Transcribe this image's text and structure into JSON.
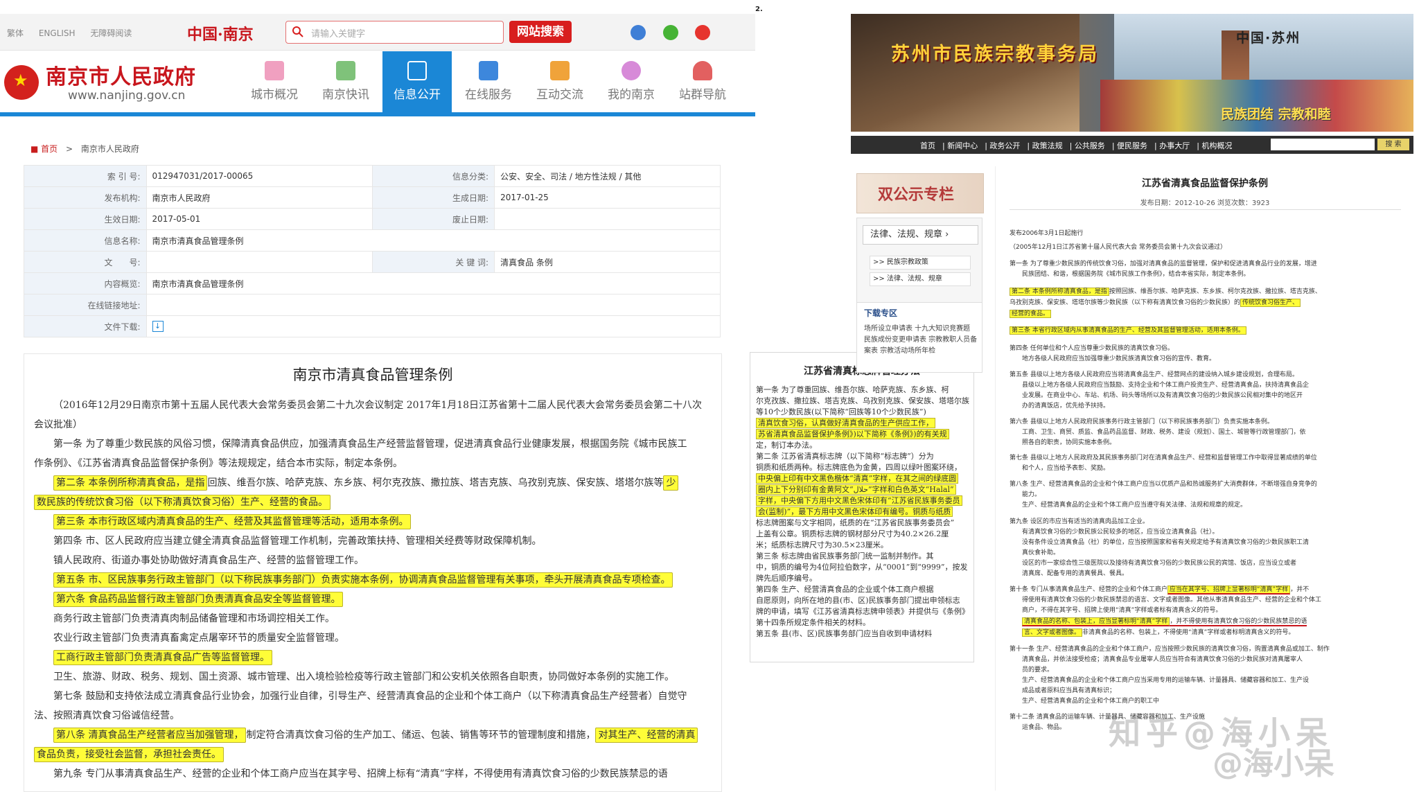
{
  "page_number": "2.",
  "nanjing": {
    "top_links": [
      "繁体",
      "ENGLISH",
      "无障碍阅读"
    ],
    "logo_text": "中国·南京",
    "search": {
      "placeholder": "请输入关键字",
      "button": "网站搜索"
    },
    "site_title": "南京市人民政府",
    "site_url": "www.nanjing.gov.cn",
    "nav": [
      "城市概况",
      "南京快讯",
      "信息公开",
      "在线服务",
      "互动交流",
      "我的南京",
      "站群导航"
    ],
    "active_nav": "信息公开",
    "colors": {
      "brand_red": "#c8161d",
      "nav_blue": "#1b87d6",
      "highlight": "#fffd38"
    },
    "breadcrumb": {
      "home": "首页",
      "sep": ">",
      "current": "南京市人民政府"
    },
    "meta": {
      "index_label": "索 引 号:",
      "index_value": "012947031/2017-00065",
      "category_label": "信息分类:",
      "category_value": "公安、安全、司法 / 地方性法规 / 其他",
      "issuer_label": "发布机构:",
      "issuer_value": "南京市人民政府",
      "created_label": "生成日期:",
      "created_value": "2017-01-25",
      "effective_label": "生效日期:",
      "effective_value": "2017-05-01",
      "abolish_label": "废止日期:",
      "abolish_value": "",
      "name_label": "信息名称:",
      "name_value": "南京市清真食品管理条例",
      "docno_label": "文　　号:",
      "docno_value": "",
      "keywords_label": "关 键 词:",
      "keywords_value": "清真食品 条例",
      "summary_label": "内容概览:",
      "summary_value": "南京市清真食品管理条例",
      "link_label": "在线链接地址:",
      "link_value": "",
      "download_label": "文件下载:"
    },
    "doc": {
      "title": "南京市清真食品管理条例",
      "lines": [
        "（2016年12月29日南京市第十五届人民代表大会常务委员会第二十九次会议制定  2017年1月18日江苏省第十二届人民代表大会常务委员会第二十八次",
        "会议批准）",
        "第一条  为了尊重少数民族的风俗习惯，保障清真食品供应，加强清真食品生产经营监督管理，促进清真食品行业健康发展，根据国务院《城市民族工",
        "作条例》、《江苏省清真食品监督保护条例》等法规规定，结合本市实际，制定本条例。"
      ],
      "art2_hl_a": "第二条  本条例所称清真食品，是指",
      "art2_mid": "回族、维吾尔族、哈萨克族、东乡族、柯尔克孜族、撒拉族、塔吉克族、乌孜别克族、保安族、塔塔尔族等",
      "art2_hl_b": "少",
      "art2_line2": "数民族的传统饮食习俗（以下称清真饮食习俗）生产、经营的食品。",
      "art3": "第三条  本市行政区域内清真食品的生产、经营及其监督管理等活动，适用本条例。",
      "art4_a": "第四条  市、区人民政府应当建立健全清真食品监督管理工作机制，完善政策扶持、管理相关经费等财政保障机制。",
      "art4_b": "镇人民政府、街道办事处协助做好清真食品生产、经营的监督管理工作。",
      "art5": "第五条  市、区民族事务行政主管部门（以下称民族事务部门）负责实施本条例，协调清真食品监督管理有关事项，牵头开展清真食品专项检查。",
      "art6": "第六条  食品药品监督行政主管部门负责清真食品安全等监督管理。",
      "art6_b": "商务行政主管部门负责清真肉制品储备管理和市场调控相关工作。",
      "art6_c": "农业行政主管部门负责清真畜禽定点屠宰环节的质量安全监督管理。",
      "art6_d": "工商行政主管部门负责清真食品广告等监督管理。",
      "art6_e": "卫生、旅游、财政、税务、规划、国土资源、城市管理、出入境检验检疫等行政主管部门和公安机关依照各自职责，协同做好本条例的实施工作。",
      "art7_a": "第七条  鼓励和支持依法成立清真食品行业协会，加强行业自律，引导生产、经营清真食品的企业和个体工商户（以下称清真食品生产经营者）自觉守",
      "art7_b": "法、按照清真饮食习俗诚信经营。",
      "art8_hl_a": "第八条  清真食品生产经营者应当加强管理，",
      "art8_mid": "制定符合清真饮食习俗的生产加工、储运、包装、销售等环节的管理制度和措施，",
      "art8_hl_b": "对其生产、经营的清真",
      "art8_line2": "食品负责，接受社会监督，承担社会责任。",
      "art9": "第九条  专门从事清真食品生产、经营的企业和个体工商户应当在其字号、招牌上标有“清真”字样，不得使用有清真饮食习俗的少数民族禁忌的语"
    }
  },
  "suzhou": {
    "bureau_name": "苏州市民族宗教事务局",
    "region": "中国·苏州",
    "slogan": "民族团结 宗教和睦",
    "nav": [
      "首页",
      "新闻中心",
      "政务公开",
      "政策法规",
      "公共服务",
      "便民服务",
      "办事大厅",
      "机构概况"
    ],
    "search_button": "搜 索",
    "sidebar": {
      "notice": "双公示专栏",
      "box_title": "法律、法规、规章",
      "links": [
        ">> 民族宗教政策",
        ">> 法律、法规、规章"
      ],
      "download_title": "下载专区",
      "download_text": "场所设立申请表 十九大知识竞赛题 民族成份变更申请表 宗教教职人员备案表 宗教活动场所年检"
    },
    "article": {
      "title": "江苏省清真食品监督保护条例",
      "subtitle": "发布日期：2012-10-26  浏览次数：3923",
      "line_published": "发布2006年3月1日起施行",
      "line_meeting": "（2005年12月1日江苏省第十届人民代表大会 常务委员会第十九次会议通过）",
      "art1_a": "第一条 为了尊重少数民族的传统饮食习俗，加强对清真食品的监督管理，保护和促进清真食品行业的发展，增进",
      "art1_b": "民族团结、和谐，根据国务院《城市民族工作条例》，结合本省实际，制定本条例。",
      "art2_hl": "第二条 本条例所称清真食品，是指",
      "art2_mid": "按照回族、维吾尔族、哈萨克族、东乡族、柯尔克孜族、撒拉族、塔吉克族、",
      "art2_b": "乌孜别克族、保安族、塔塔尔族等少数民族（以下称有清真饮食习俗的少数民族）的",
      "art2_hl_b": "传统饮食习俗生产、",
      "art2_hl_c": "经营的食品。",
      "art3_hl": "第三条 本省行政区域内从事清真食品的生产、经营及其监督管理活动，适用本条例。",
      "art4_a": "第四条 任何单位和个人应当尊重少数民族的清真饮食习俗。",
      "art4_b": "地方各级人民政府应当加强尊重少数民族清真饮食习俗的宣传、教育。",
      "art5_a": "第五条 县级以上地方各级人民政府应当将清真食品生产、经营网点的建设纳入城乡建设规划，合理布局。",
      "art5_b": "县级以上地方各级人民政府应当鼓励、支持企业和个体工商户投资生产、经营清真食品，扶持清真食品企",
      "art5_c": "业发展。在商业中心、车站、机场、码头等场所以及有清真饮食习俗的少数民族公民相对集中的地区开",
      "art5_d": "办的清真饭店，优先给予扶持。",
      "art6_a": "第六条 县级以上地方人民政府民族事务行政主管部门（以下称民族事务部门）负责实施本条例。",
      "art6_b": "工商、卫生、商贸、质监、食品药品监督、财政、税务、建设（规划）、国土、城管等行政管理部门，依",
      "art6_c": "照各自的职责，协同实施本条例。",
      "art7_a": "第七条 县级以上地方人民政府及其民族事务部门对在清真食品生产、经营和监督管理工作中取得显著成绩的单位",
      "art7_b": "和个人，应当给予表彰、奖励。",
      "art8_a": "第八条 生产、经营清真食品的企业和个体工商户应当以优质产品和热诚服务扩大消费群体，不断增强自身竞争的",
      "art8_b": "能力。",
      "art8_c": "生产、经营清真食品的企业和个体工商户应当遵守有关法律、法规和规章的规定。",
      "art9_a": "第九条 设区的市应当有适当的清真肉品加工企业。",
      "art9_b": "有清真饮食习俗的少数民族公民较多的地区，应当设立清真食品（社）。",
      "art9_c": "没有条件设立清真食品（社）的单位，应当按照国家和省有关规定给予有清真饮食习俗的少数民族职工清",
      "art9_d": "真伙食补助。",
      "art9_e": "设区的市一家综合性三级医院以及接待有清真饮食习俗的少数民族公民的宾馆、饭店，应当设立或者",
      "art9_f": "清真席、配备专用的清真餐具、餐具。",
      "art10_a": "第十条 专门从事清真食品生产、经营的企业和个体工商户",
      "art10_hl": "应当在其字号、招牌上显著标明“清真”字样",
      "art10_a2": "，并不",
      "art10_b": "得使用有清真饮食习俗的少数民族禁忌的语言、文字或者图像。其他从事清真食品生产、经营的企业和个体工",
      "art10_c": "商户，不得在其字号、招牌上使用“清真”字样或者标有清真含义的符号。",
      "art10_hl2": "清真食品的名称、包装上，应当显著标明“清真”字样",
      "art10_d2": "，并不得使用有清真饮食习俗的少数民族禁忌的语",
      "art10_hl3": "言、文字或者图像。",
      "art10_e2": "非清真食品的名称、包装上，不得使用“清真”字样或者标明清真含义的符号。",
      "art11_a": "第十一条 生产、经营清真食品的企业和个体工商户，应当按照少数民族的清真饮食习俗，购置清真食品或加工、制作",
      "art11_b": "清真食品，并依法接受检疫；清真食品专业屠宰人员应当符合有清真饮食习俗的少数民族对清真屠宰人",
      "art11_c": "员的要求。",
      "art11_d": "生产、经营清真食品的企业和个体工商户应当采用专用的运输车辆、计量器具、储藏容器和加工、生产设",
      "art11_e": "成品或者原料应当具有清真标识；",
      "art11_f": "生产、经营清真食品的企业和个体工商户的职工中",
      "art12": "第十二条 清真食品的运输车辆、计量器具、储藏容器和加工、生产设施",
      "art12_b": "运食品、物品。"
    }
  },
  "jiangsu_clip": {
    "title": "江苏省清真标志牌管理办法",
    "lines": [
      "第一条  为了尊重回族、维吾尔族、哈萨克族、东乡族、柯",
      "尔克孜族、撒拉族、塔吉克族、乌孜别克族、保安族、塔塔尔族",
      "等10个少数民族(以下简称“回族等10个少数民族”)",
      "清真饮食习俗，认真做好清真食品的生产供应工作，",
      "苏省清真食品监督保护条例》)以下简称《条例》)的有关规",
      "定，制订本办法。",
      "第二条  江苏省清真标志牌（以下简称“标志牌”）分为",
      "铜质和纸质两种。标志牌底色为金黄，四周以绿叶图案环绕，",
      "中央偏上印有中文黑色楷体“清真”字样，在其之间的绿底圆",
      "圈内上下分别印有金黄阿文“حلال”字样和白色英文“Halal”",
      "字样，中央偏下方用中文黑色宋体印有“江苏省民族事务委员",
      "会(监制)”，最下方用中文黑色宋体印有编号。铜质与纸质",
      "标志牌图案与文字相同，纸质的在“江苏省民族事务委员会”",
      "上盖有公章。铜质标志牌的钢材部分尺寸为40.2×26.2厘",
      "米；纸质标志牌尺寸为30.5×23厘米。",
      "第三条  标志牌由省民族事务部门统一监制并制作。其",
      "中，铜质的编号为4位阿拉伯数字，从“0001”到“9999”，按发",
      "牌先后顺序编号。",
      "第四条  生产、经营清真食品的企业或个体工商户根据",
      "自愿原则，向所在地的县(市、区)民族事务部门提出申领标志",
      "牌的申请，填写《江苏省清真标志牌申领表》并提供与《条例》",
      "第十四条所规定条件相关的材料。",
      "第五条  县(市、区)民族事务部门应当自收到申请材料"
    ]
  },
  "watermark": {
    "line1": "知乎@海小呆",
    "line2": "@海小呆"
  }
}
